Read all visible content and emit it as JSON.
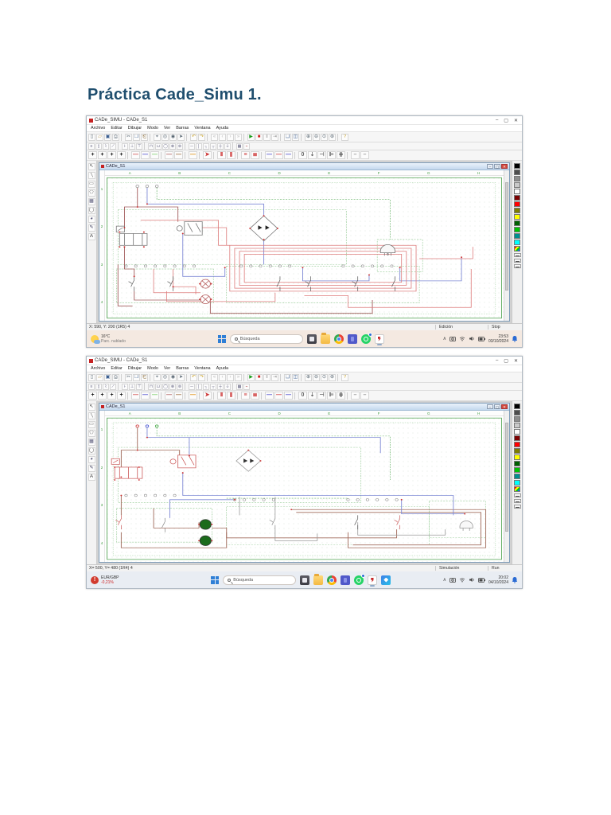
{
  "page": {
    "title": "Práctica Cade_Simu 1."
  },
  "app": {
    "window_title": "CADe_SIMU - CADe_S1",
    "child_window_title": "CADe_S1",
    "menu_items": [
      "Archivo",
      "Editar",
      "Dibujar",
      "Modo",
      "Ver",
      "Barras",
      "Ventana",
      "Ayuda"
    ],
    "ruler_letters": [
      "A",
      "B",
      "C",
      "D",
      "E",
      "F",
      "G",
      "H"
    ],
    "ruler_numbers": [
      "1",
      "2",
      "3",
      "4"
    ],
    "window_buttons": {
      "minimize": "–",
      "maximize": "▢",
      "close": "✕"
    },
    "child_buttons": {
      "minimize": "–",
      "maximize": "▢",
      "close": "✕"
    },
    "palette_colors": [
      "#000000",
      "#4d4d4d",
      "#8c8c8c",
      "#c9c9c9",
      "#ffffff",
      "#7d0000",
      "#ff0000",
      "#7d7d00",
      "#ffff00",
      "#005f00",
      "#00c300",
      "#008f8f",
      "#00ffff",
      "rainbow"
    ],
    "toolbar_main": [
      {
        "n": "new",
        "g": "▯",
        "c": "#55636f"
      },
      {
        "n": "open",
        "g": "▱",
        "c": "#b08c3a"
      },
      {
        "n": "save",
        "g": "▣",
        "c": "#3a5d8f"
      },
      {
        "n": "print",
        "g": "⎙",
        "c": "#55636f"
      },
      {
        "sep": true
      },
      {
        "n": "cut",
        "g": "✂",
        "c": "#55636f"
      },
      {
        "n": "copy",
        "g": "❐",
        "c": "#3a5d8f"
      },
      {
        "n": "paste",
        "g": "⎗",
        "c": "#8a6d3b"
      },
      {
        "sep": true
      },
      {
        "n": "find",
        "g": "⌖",
        "c": "#55636f"
      },
      {
        "n": "find-component",
        "g": "◎",
        "c": "#55636f"
      },
      {
        "n": "find-wire",
        "g": "◉",
        "c": "#55636f"
      },
      {
        "n": "pointer",
        "g": "➤",
        "c": "#55636f"
      },
      {
        "sep": true
      },
      {
        "n": "undo",
        "g": "↶",
        "c": "#c9a227"
      },
      {
        "n": "redo",
        "g": "↷",
        "c": "#c9a227"
      },
      {
        "sep": true
      },
      {
        "n": "go-first",
        "g": "«",
        "c": "#bbbbbb"
      },
      {
        "n": "step-back",
        "g": "‹",
        "c": "#bbbbbb"
      },
      {
        "n": "step-forward",
        "g": "›",
        "c": "#bbbbbb"
      },
      {
        "n": "go-last",
        "g": "»",
        "c": "#bbbbbb"
      },
      {
        "sep": true
      },
      {
        "n": "simulate-play",
        "g": "▶",
        "c": "#1d9e1d"
      },
      {
        "n": "simulate-stop",
        "g": "■",
        "c": "#d22222"
      },
      {
        "n": "simulate-pause",
        "g": "‖",
        "c": "#999999"
      },
      {
        "n": "simulate-step",
        "g": "⇥",
        "c": "#999999"
      },
      {
        "sep": true
      },
      {
        "n": "window-cascade",
        "g": "❏",
        "c": "#3a5d8f"
      },
      {
        "n": "window-tile",
        "g": "◫",
        "c": "#3a5d8f"
      },
      {
        "sep": true
      },
      {
        "n": "zoom-in",
        "g": "⊕",
        "c": "#55636f"
      },
      {
        "n": "zoom-out",
        "g": "⊖",
        "c": "#55636f"
      },
      {
        "n": "zoom-window",
        "g": "⊙",
        "c": "#55636f"
      },
      {
        "n": "zoom-page",
        "g": "⊛",
        "c": "#55636f"
      },
      {
        "sep": true
      },
      {
        "n": "help",
        "g": "?",
        "c": "#c9a227"
      }
    ],
    "toolbar_symbols": [
      {
        "n": "power-lines",
        "g": "≡",
        "c": "#5a5a7a"
      },
      {
        "n": "fuse",
        "g": "▯",
        "c": "#5a5a7a"
      },
      {
        "n": "breaker",
        "g": "⌇",
        "c": "#5a5a7a"
      },
      {
        "n": "disconnector",
        "g": "⟋",
        "c": "#5a5a7a"
      },
      {
        "sep": true
      },
      {
        "n": "contact-no",
        "g": "⊦",
        "c": "#5a5a7a"
      },
      {
        "n": "contact-nc",
        "g": "⊥",
        "c": "#5a5a7a"
      },
      {
        "n": "pushbutton",
        "g": "⊤",
        "c": "#5a5a7a"
      },
      {
        "sep": true
      },
      {
        "n": "coil",
        "g": "⊓",
        "c": "#5a5a7a"
      },
      {
        "n": "timer",
        "g": "⊔",
        "c": "#5a5a7a"
      },
      {
        "n": "motor",
        "g": "◯",
        "c": "#5a5a7a"
      },
      {
        "n": "lamp",
        "g": "⊗",
        "c": "#5a5a7a"
      },
      {
        "n": "terminal",
        "g": "⊚",
        "c": "#5a5a7a"
      },
      {
        "sep": true
      },
      {
        "n": "wire-horizontal",
        "g": "─",
        "c": "#5a5a7a"
      },
      {
        "n": "wire-vertical",
        "g": "│",
        "c": "#5a5a7a"
      },
      {
        "n": "wire-corner",
        "g": "┐",
        "c": "#5a5a7a"
      },
      {
        "n": "wire-tee",
        "g": "┬",
        "c": "#5a5a7a"
      },
      {
        "n": "wire-cross",
        "g": "┼",
        "c": "#5a5a7a"
      },
      {
        "n": "ground",
        "g": "⏚",
        "c": "#5a5a7a"
      },
      {
        "sep": true
      },
      {
        "n": "block",
        "g": "▦",
        "c": "#5a5a7a"
      },
      {
        "n": "cable",
        "g": "⌁",
        "c": "#b35555"
      }
    ],
    "toolbar_draw": [
      {
        "n": "junction-1",
        "g": "+",
        "c": "#111111"
      },
      {
        "n": "junction-2",
        "g": "+",
        "c": "#111111"
      },
      {
        "n": "junction-3",
        "g": "+",
        "c": "#111111"
      },
      {
        "n": "junction-4",
        "g": "+",
        "c": "#111111"
      },
      {
        "sep": true
      },
      {
        "n": "wire-red",
        "g": "—",
        "c": "#d04444"
      },
      {
        "n": "wire-blue",
        "g": "—",
        "c": "#4444cc"
      },
      {
        "n": "wire-green",
        "g": "—",
        "c": "#77cc66"
      },
      {
        "sep": true
      },
      {
        "n": "wire-maroon",
        "g": "—",
        "c": "#aa5555"
      },
      {
        "n": "wire-brown",
        "g": "—",
        "c": "#996633"
      },
      {
        "sep": true
      },
      {
        "n": "wire-orange",
        "g": "—",
        "c": "#dd8800"
      },
      {
        "sep": true
      },
      {
        "n": "arrow-marker",
        "g": "➤",
        "c": "#cc3333"
      },
      {
        "sep": true
      },
      {
        "n": "bus-bars",
        "g": "⦀",
        "c": "#cc3333"
      },
      {
        "n": "bus-numbered",
        "g": "⫼",
        "c": "#cc3333"
      },
      {
        "sep": true
      },
      {
        "n": "lines-pack",
        "g": "≡",
        "c": "#cc3333"
      },
      {
        "n": "lines-pack-2",
        "g": "≣",
        "c": "#cc3333"
      },
      {
        "sep": true
      },
      {
        "n": "line-blue-a",
        "g": "—",
        "c": "#4444cc"
      },
      {
        "n": "line-red-b",
        "g": "—",
        "c": "#cc3333"
      },
      {
        "n": "line-blue-c",
        "g": "—",
        "c": "#4444cc"
      },
      {
        "sep": true
      },
      {
        "n": "zero-marker",
        "g": "0",
        "c": "#666666"
      },
      {
        "n": "probe",
        "g": "⇣",
        "c": "#666666"
      },
      {
        "n": "node-single",
        "g": "⊣",
        "c": "#666666"
      },
      {
        "n": "node-double",
        "g": "⊫",
        "c": "#666666"
      },
      {
        "n": "node-triple",
        "g": "⋕",
        "c": "#666666"
      },
      {
        "sep": true
      },
      {
        "n": "dash-short",
        "g": "–",
        "c": "#888888"
      },
      {
        "n": "dash-long",
        "g": "–",
        "c": "#888888"
      }
    ],
    "toolbox_left": [
      {
        "n": "select-tool",
        "g": "↖",
        "c": "#333333"
      },
      {
        "n": "line-tool",
        "g": "╲",
        "c": "#555555"
      },
      {
        "n": "rect-tool",
        "g": "▭",
        "c": "#555555"
      },
      {
        "n": "polygon-tool",
        "g": "⬠",
        "c": "#555555"
      },
      {
        "n": "image-tool",
        "g": "▦",
        "c": "#555577"
      },
      {
        "n": "ellipse-tool",
        "g": "◯",
        "c": "#555555"
      },
      {
        "n": "fill-tool",
        "g": "◕",
        "c": "#555577"
      },
      {
        "n": "pen-tool",
        "g": "✎",
        "c": "#333355"
      },
      {
        "n": "text-tool",
        "g": "A",
        "c": "#333333"
      }
    ]
  },
  "shot1": {
    "status_left": "X: 590, Y: 200 (1R5) 4",
    "status_mode": "Edición",
    "status_state": "Stop",
    "taskbar_style": "background:#f4e9e1",
    "taskbar": {
      "widget_line1": "16°C",
      "widget_line2": "Parc. nublado",
      "search_placeholder": "Búsqueda",
      "time": "23:53",
      "date": "03/10/2024"
    }
  },
  "shot2": {
    "status_left": "X= 500, Y= 480 (1R4) 4",
    "status_mode": "Simulación",
    "status_state": "Run",
    "taskbar_style": "background:#e9edf3",
    "taskbar": {
      "widget_line1": "EUR/GBP",
      "widget_line2": "-0,21%",
      "search_placeholder": "Búsqueda",
      "time": "20:02",
      "date": "04/10/2024"
    }
  },
  "colors": {
    "accent_title": "#1f4e6e",
    "page_border_green": "#5aa85a",
    "section_green": "#7cbf7c",
    "wire_red": "#dd7c7c",
    "wire_dark_red": "#a35d5d",
    "wire_blue": "#7f8ad6",
    "wire_green": "#69b369",
    "wire_brown": "#a06a5a",
    "wire_gray": "#9a9a9a",
    "component_gray": "#777777",
    "component_red": "#cc5c5c",
    "junction_red": "#cc3333",
    "lamp_on": "#1c6b1c"
  }
}
